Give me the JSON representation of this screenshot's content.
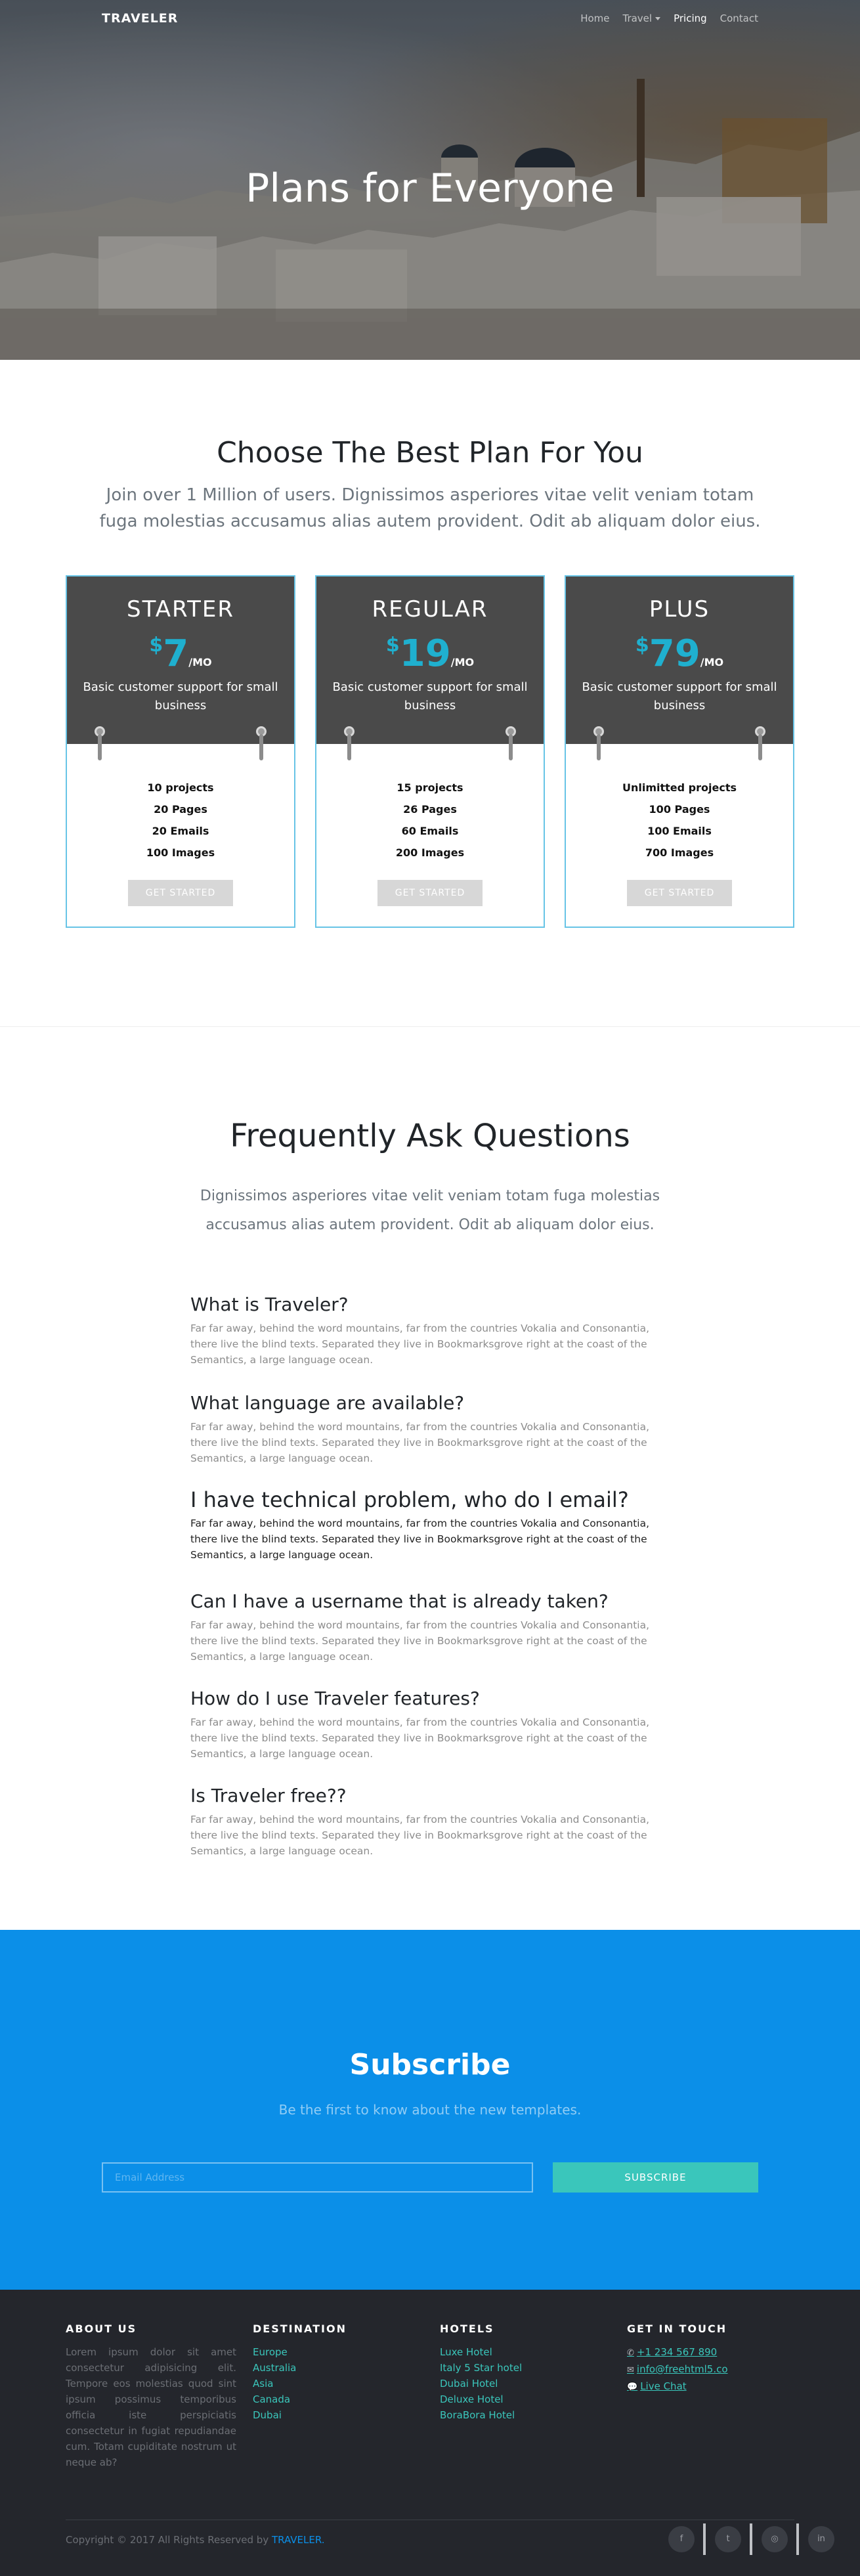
{
  "nav": {
    "brand": "TRAVELER",
    "links": [
      {
        "label": "Home"
      },
      {
        "label": "Travel"
      },
      {
        "label": "Pricing"
      },
      {
        "label": "Contact"
      }
    ]
  },
  "hero": {
    "title": "Plans for Everyone"
  },
  "pricing": {
    "title": "Choose The Best Plan For You",
    "subtitle": "Join over 1 Million of users. Dignissimos asperiores vitae velit veniam totam fuga molestias accusamus alias autem provident. Odit ab aliquam dolor eius.",
    "plans": [
      {
        "name": "STARTER",
        "currency": "$",
        "amount": "7",
        "period": "/MO",
        "description": "Basic customer support for small business",
        "features": [
          "10 projects",
          "20 Pages",
          "20 Emails",
          "100 Images"
        ],
        "button": "GET STARTED"
      },
      {
        "name": "REGULAR",
        "currency": "$",
        "amount": "19",
        "period": "/MO",
        "description": "Basic customer support for small business",
        "features": [
          "15 projects",
          "26 Pages",
          "60 Emails",
          "200 Images"
        ],
        "button": "GET STARTED"
      },
      {
        "name": "PLUS",
        "currency": "$",
        "amount": "79",
        "period": "/MO",
        "description": "Basic customer support for small business",
        "features": [
          "Unlimitted projects",
          "100 Pages",
          "100 Emails",
          "700 Images"
        ],
        "button": "GET STARTED"
      }
    ]
  },
  "faq": {
    "title": "Frequently Ask Questions",
    "subtitle": "Dignissimos asperiores vitae velit veniam totam fuga molestias accusamus alias autem provident. Odit ab aliquam dolor eius.",
    "items": [
      {
        "question": "What is Traveler?",
        "answer": "Far far away, behind the word mountains, far from the countries Vokalia and Consonantia, there live the blind texts. Separated they live in Bookmarksgrove right at the coast of the Semantics, a large language ocean."
      },
      {
        "question": "What language are available?",
        "answer": "Far far away, behind the word mountains, far from the countries Vokalia and Consonantia, there live the blind texts. Separated they live in Bookmarksgrove right at the coast of the Semantics, a large language ocean."
      },
      {
        "question": "I have technical problem, who do I email?",
        "answer": "Far far away, behind the word mountains, far from the countries Vokalia and Consonantia, there live the blind texts. Separated they live in Bookmarksgrove right at the coast of the Semantics, a large language ocean."
      },
      {
        "question": "Can I have a username that is already taken?",
        "answer": "Far far away, behind the word mountains, far from the countries Vokalia and Consonantia, there live the blind texts. Separated they live in Bookmarksgrove right at the coast of the Semantics, a large language ocean."
      },
      {
        "question": "How do I use Traveler features?",
        "answer": "Far far away, behind the word mountains, far from the countries Vokalia and Consonantia, there live the blind texts. Separated they live in Bookmarksgrove right at the coast of the Semantics, a large language ocean."
      },
      {
        "question": "Is Traveler free??",
        "answer": "Far far away, behind the word mountains, far from the countries Vokalia and Consonantia, there live the blind texts. Separated they live in Bookmarksgrove right at the coast of the Semantics, a large language ocean."
      }
    ]
  },
  "subscribe": {
    "title": "Subscribe",
    "subtitle": "Be the first to know about the new templates.",
    "placeholder": "Email Address",
    "button": "SUBSCRIBE"
  },
  "footer": {
    "about": {
      "heading": "ABOUT US",
      "text": "Lorem ipsum dolor sit amet consectetur adipisicing elit. Tempore eos molestias quod sint ipsum possimus temporibus officia iste perspiciatis consectetur in fugiat repudiandae cum. Totam cupiditate nostrum ut neque ab?"
    },
    "destination": {
      "heading": "DESTINATION",
      "links": [
        "Europe",
        "Australia",
        "Asia",
        "Canada",
        "Dubai"
      ]
    },
    "hotels": {
      "heading": "HOTELS",
      "links": [
        "Luxe Hotel",
        "Italy 5 Star hotel",
        "Dubai Hotel",
        "Deluxe Hotel",
        "BoraBora Hotel"
      ]
    },
    "contact": {
      "heading": "GET IN TOUCH",
      "phone": "+1 234 567 890",
      "email": "info@freehtml5.co",
      "chat": "Live Chat"
    },
    "copyright": "Copyright © 2017 All Rights Reserved by ",
    "copyright_link": "TRAVELER.",
    "socials": [
      {
        "icon": "facebook-icon",
        "glyph": "f"
      },
      {
        "icon": "twitter-icon",
        "glyph": "t"
      },
      {
        "icon": "dribbble-icon",
        "glyph": "◎"
      },
      {
        "icon": "linkedin-icon",
        "glyph": "in"
      }
    ]
  },
  "colors": {
    "accent_blue": "#0b8fe8",
    "teal": "#3ac6bb",
    "price_cyan": "#1fb0cf",
    "card_border": "#67c4e6",
    "card_head": "#4a4a4a",
    "footer_bg": "#24262c"
  }
}
